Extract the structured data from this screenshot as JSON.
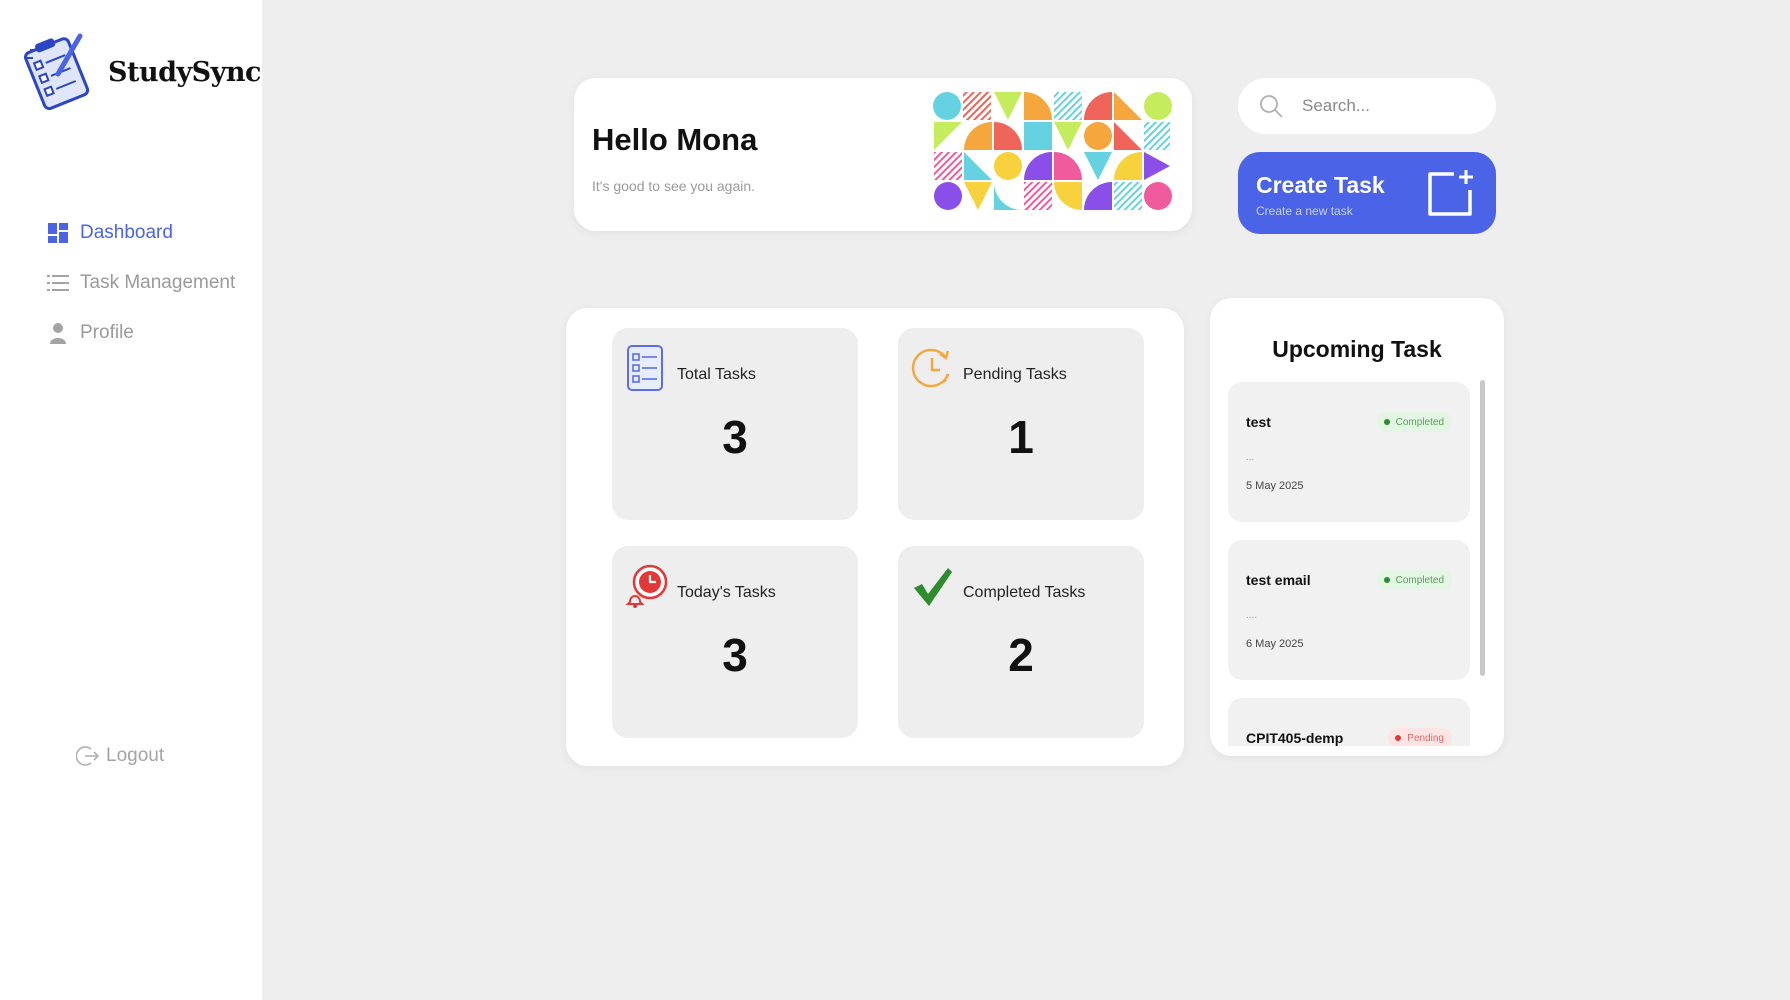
{
  "app": {
    "name": "StudySync"
  },
  "sidebar": {
    "items": [
      {
        "label": "Dashboard",
        "icon": "dashboard-icon",
        "active": true
      },
      {
        "label": "Task Management",
        "icon": "list-icon",
        "active": false
      },
      {
        "label": "Profile",
        "icon": "user-icon",
        "active": false
      }
    ],
    "logout_label": "Logout"
  },
  "greeting": {
    "title": "Hello Mona",
    "subtitle": "It's good to see you again."
  },
  "search": {
    "placeholder": "Search..."
  },
  "create_task": {
    "title": "Create Task",
    "subtitle": "Create a new task"
  },
  "stats": [
    {
      "label": "Total Tasks",
      "value": "3",
      "icon": "checklist-icon"
    },
    {
      "label": "Pending Tasks",
      "value": "1",
      "icon": "clock-icon"
    },
    {
      "label": "Today's Tasks",
      "value": "3",
      "icon": "alarm-icon"
    },
    {
      "label": "Completed Tasks",
      "value": "2",
      "icon": "checkmark-icon"
    }
  ],
  "upcoming": {
    "title": "Upcoming Task",
    "tasks": [
      {
        "name": "test",
        "status": "Completed",
        "description": "...",
        "date": "5 May 2025"
      },
      {
        "name": "test email",
        "status": "Completed",
        "description": "....",
        "date": "6 May 2025"
      },
      {
        "name": "CPIT405-demp",
        "status": "Pending",
        "description": "",
        "date": ""
      }
    ]
  },
  "colors": {
    "accent": "#4a63e7",
    "background": "#eeeeee",
    "completed": "#2e8b2e",
    "pending": "#e23838"
  }
}
